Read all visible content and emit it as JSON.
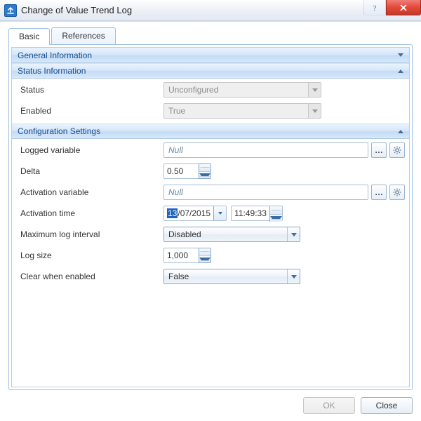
{
  "window": {
    "title": "Change of Value Trend Log"
  },
  "tabs": {
    "basic": "Basic",
    "references": "References"
  },
  "sections": {
    "general": {
      "title": "General Information"
    },
    "status": {
      "title": "Status Information"
    },
    "config": {
      "title": "Configuration Settings"
    }
  },
  "status": {
    "status_label": "Status",
    "status_value": "Unconfigured",
    "enabled_label": "Enabled",
    "enabled_value": "True"
  },
  "config": {
    "logged_variable": {
      "label": "Logged variable",
      "value": "Null"
    },
    "delta": {
      "label": "Delta",
      "value": "0.50"
    },
    "activation_var": {
      "label": "Activation variable",
      "value": "Null"
    },
    "activation_time": {
      "label": "Activation time",
      "date_day": "13",
      "date_rest": "/07/2015",
      "time": "11:49:33"
    },
    "max_interval": {
      "label": "Maximum log interval",
      "value": "Disabled"
    },
    "log_size": {
      "label": "Log size",
      "value": "1,000"
    },
    "clear_enabled": {
      "label": "Clear when enabled",
      "value": "False"
    }
  },
  "footer": {
    "ok": "OK",
    "close": "Close"
  }
}
